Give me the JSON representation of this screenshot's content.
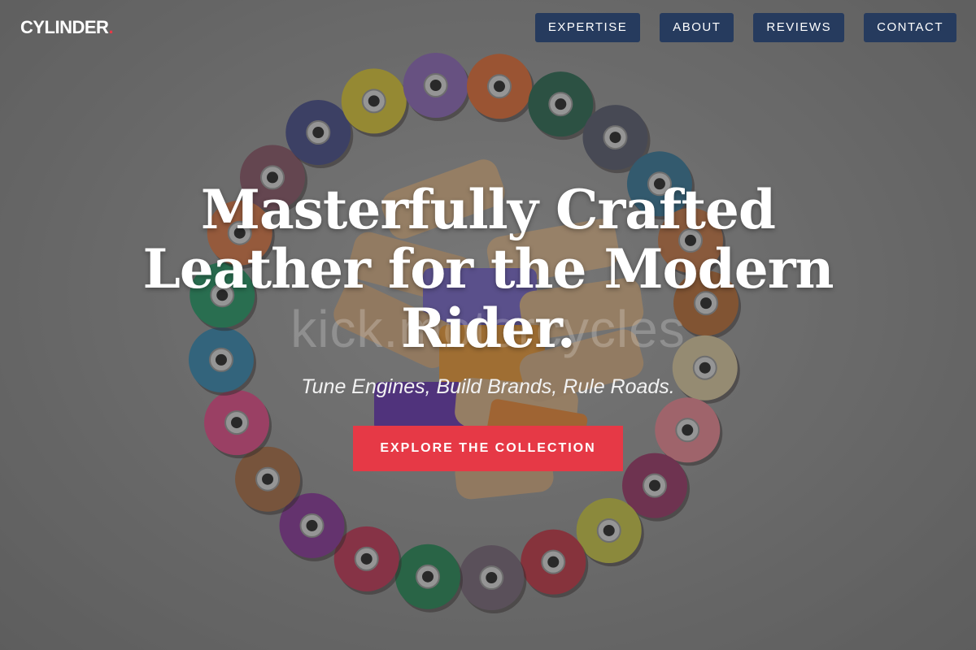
{
  "brand": {
    "name": "CYLINDER",
    "dot": ".",
    "accent_color": "#e63946"
  },
  "nav": {
    "items": [
      {
        "label": "EXPERTISE"
      },
      {
        "label": "ABOUT"
      },
      {
        "label": "REVIEWS"
      },
      {
        "label": "CONTACT"
      }
    ],
    "button_color": "#263b5e"
  },
  "hero": {
    "watermark": "kick.motorcycles",
    "headline": "Masterfully Crafted Leather for the Modern Rider.",
    "tagline": "Tune Engines, Build Brands, Rule Roads.",
    "cta_label": "EXPLORE THE COLLECTION",
    "cta_color": "#e63946",
    "background_image": "thread-spools-photo",
    "spool_colors": [
      "#8a5a6a",
      "#4a4f8a",
      "#d9c53a",
      "#8e6bb8",
      "#e0703a",
      "#2f6b55",
      "#5b5e70",
      "#3a7a9a",
      "#c67a4a",
      "#b8703a",
      "#d9c8a0",
      "#e88a95",
      "#9a3a6a",
      "#c9c64a",
      "#c03a4a",
      "#7a6a7a",
      "#2a8a5a",
      "#c03a5a",
      "#8a3a9a",
      "#a8704a",
      "#e0508a",
      "#3a8ab0",
      "#2a9a6a",
      "#d87a4a"
    ]
  }
}
